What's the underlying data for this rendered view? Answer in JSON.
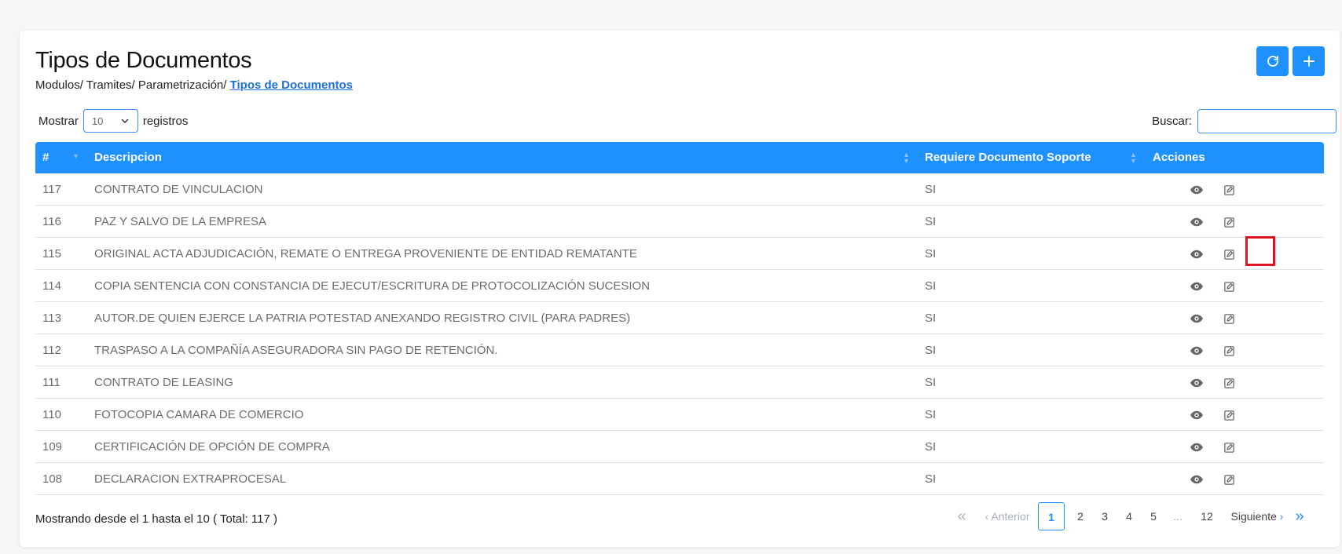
{
  "page": {
    "title": "Tipos de Documentos",
    "breadcrumb": [
      "Modulos/ ",
      "Tramites/ ",
      "Parametrización/ "
    ],
    "breadcrumb_active": "Tipos de Documentos"
  },
  "toolbar": {
    "refresh_icon": "refresh-icon",
    "add_icon": "plus-icon"
  },
  "length": {
    "prefix": "Mostrar",
    "value": "10",
    "suffix": "registros"
  },
  "search": {
    "label": "Buscar:",
    "value": "",
    "placeholder": ""
  },
  "table": {
    "headers": {
      "num": "#",
      "desc": "Descripcion",
      "req": "Requiere Documento Soporte",
      "act": "Acciones"
    },
    "rows": [
      {
        "id": "117",
        "desc": "CONTRATO DE VINCULACION",
        "req": "SI"
      },
      {
        "id": "116",
        "desc": "PAZ Y SALVO DE LA EMPRESA",
        "req": "SI"
      },
      {
        "id": "115",
        "desc": "ORIGINAL ACTA ADJUDICACIÓN, REMATE O ENTREGA PROVENIENTE DE ENTIDAD REMATANTE",
        "req": "SI"
      },
      {
        "id": "114",
        "desc": "COPIA SENTENCIA CON CONSTANCIA DE EJECUT/ESCRITURA DE PROTOCOLIZACIÓN SUCESION",
        "req": "SI"
      },
      {
        "id": "113",
        "desc": "AUTOR.DE QUIEN EJERCE LA PATRIA POTESTAD ANEXANDO REGISTRO CIVIL (PARA PADRES)",
        "req": "SI"
      },
      {
        "id": "112",
        "desc": "TRASPASO A LA COMPAÑÍA ASEGURADORA SIN PAGO DE RETENCIÓN.",
        "req": "SI"
      },
      {
        "id": "111",
        "desc": "CONTRATO DE LEASING",
        "req": "SI"
      },
      {
        "id": "110",
        "desc": "FOTOCOPIA CAMARA DE COMERCIO",
        "req": "SI"
      },
      {
        "id": "109",
        "desc": "CERTIFICACIÓN DE OPCIÓN DE COMPRA",
        "req": "SI"
      },
      {
        "id": "108",
        "desc": "DECLARACION EXTRAPROCESAL",
        "req": "SI"
      }
    ]
  },
  "footer": {
    "info": "Mostrando desde el 1 hasta el 10 ( Total: 117 )",
    "pager": {
      "first": "«",
      "prev": "Anterior",
      "pages": [
        "1",
        "2",
        "3",
        "4",
        "5"
      ],
      "ellipsis": "...",
      "last_page": "12",
      "next": "Siguiente",
      "last": "»",
      "current": "1"
    }
  },
  "colors": {
    "primary": "#1e90ff",
    "highlight": "#e0141e",
    "link": "#1e6fd9"
  }
}
